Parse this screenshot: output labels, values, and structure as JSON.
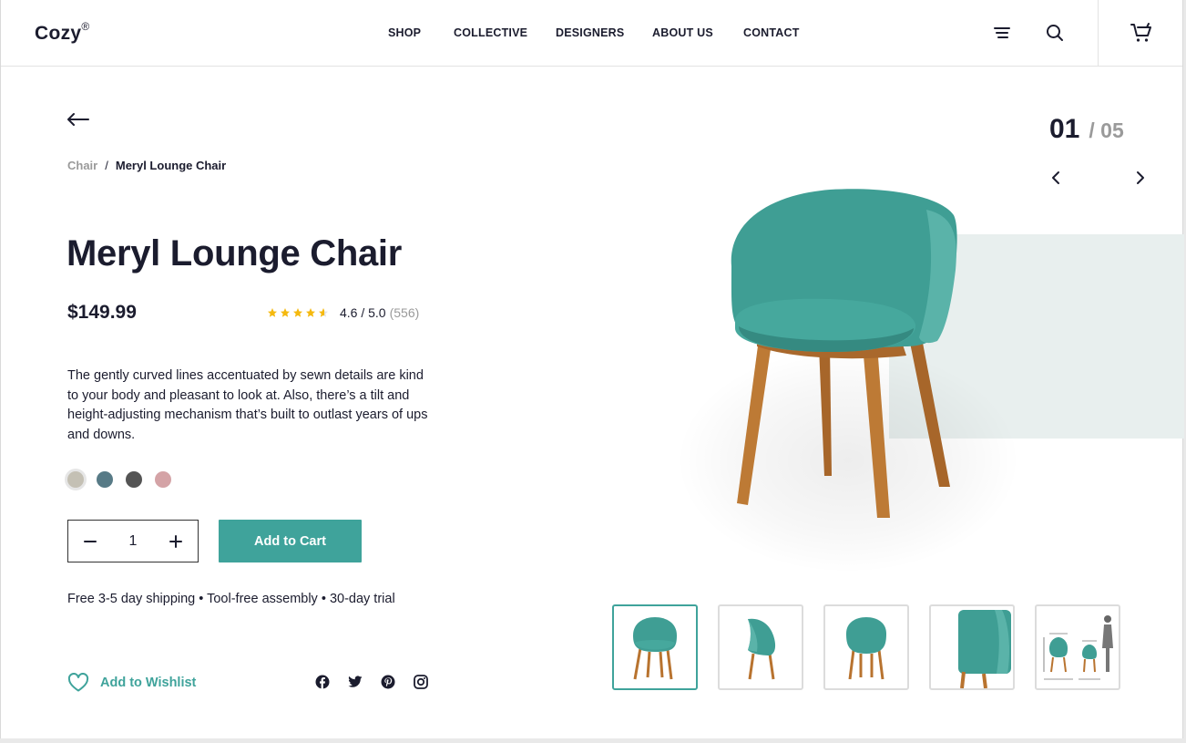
{
  "header": {
    "logo": "Cozy",
    "logo_mark": "®",
    "nav": [
      "SHOP",
      "COLLECTIVE",
      "DESIGNERS",
      "ABOUT US",
      "CONTACT"
    ],
    "icons": [
      "menu-icon",
      "search-icon",
      "cart-icon"
    ]
  },
  "breadcrumb": {
    "parent": "Chair",
    "separator": "/",
    "current": "Meryl Lounge Chair"
  },
  "product": {
    "title": "Meryl Lounge Chair",
    "price": "$149.99",
    "rating": {
      "stars": 4.6,
      "score": "4.6 / 5.0",
      "count": "(556)"
    },
    "description": "The gently curved lines accentuated by sewn details are kind to your body and pleasant to look at. Also, there’s a tilt and height-adjusting mechanism that’s built to outlast years of ups and downs.",
    "colors": [
      "#c4c0b4",
      "#577a86",
      "#545454",
      "#d4a3a6"
    ],
    "selected_color_index": 0,
    "quantity": "1",
    "add_to_cart": "Add to Cart",
    "perks": "Free 3-5 day shipping  •  Tool-free assembly  •  30-day trial",
    "wishlist": "Add to Wishlist",
    "social": [
      "facebook-icon",
      "twitter-icon",
      "pinterest-icon",
      "instagram-icon"
    ]
  },
  "gallery": {
    "current": "01",
    "total": "/ 05",
    "thumbnails": [
      "front view",
      "side view",
      "back view",
      "detail view",
      "dimensions"
    ],
    "active_index": 0
  },
  "colors": {
    "accent": "#3fa39b",
    "text": "#1b1c2e",
    "muted": "#9a9a9a",
    "star": "#f5b90f",
    "chair": "#3f9e94",
    "wood": "#b8732f"
  }
}
